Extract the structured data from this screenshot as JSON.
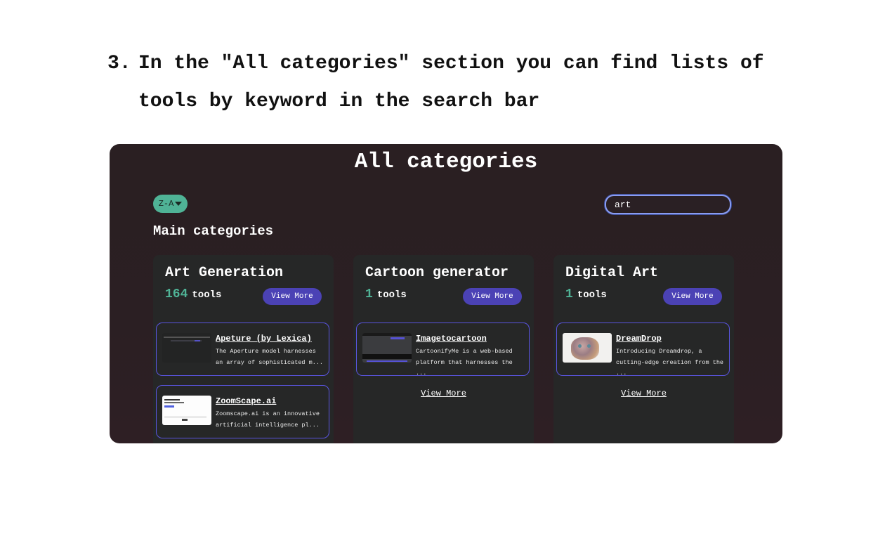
{
  "instruction": {
    "number": "3.",
    "text": "In the \"All categories\" section you can find lists of tools by keyword in the search bar"
  },
  "panel": {
    "title": "All categories",
    "sort_label": "Z-A",
    "search_value": "art",
    "main_categories_label": "Main categories"
  },
  "columns": [
    {
      "name": "Art Generation",
      "count": "164",
      "count_suffix": "tools",
      "view_more_button": "View More",
      "tools": [
        {
          "name": "Apeture (by Lexica)",
          "desc": "The Aperture model harnesses an array of sophisticated m..."
        },
        {
          "name": "ZoomScape.ai",
          "desc": "Zoomscape.ai is an innovative artificial intelligence pl..."
        }
      ]
    },
    {
      "name": "Cartoon generator",
      "count": "1",
      "count_suffix": "tools",
      "view_more_button": "View More",
      "tools": [
        {
          "name": "Imagetocartoon",
          "desc": "CartoonifyMe is a web-based platform that harnesses the ..."
        }
      ],
      "view_more_link": "View More"
    },
    {
      "name": "Digital Art",
      "count": "1",
      "count_suffix": "tools",
      "view_more_button": "View More",
      "tools": [
        {
          "name": "DreamDrop",
          "desc": "Introducing Dreamdrop, a cutting-edge creation from the ..."
        }
      ],
      "view_more_link": "View More"
    }
  ],
  "colors": {
    "accent_green": "#4fb396",
    "accent_purple": "#4b42b5",
    "card_border": "#5a55e0",
    "panel_bg": "#2a1f22"
  }
}
